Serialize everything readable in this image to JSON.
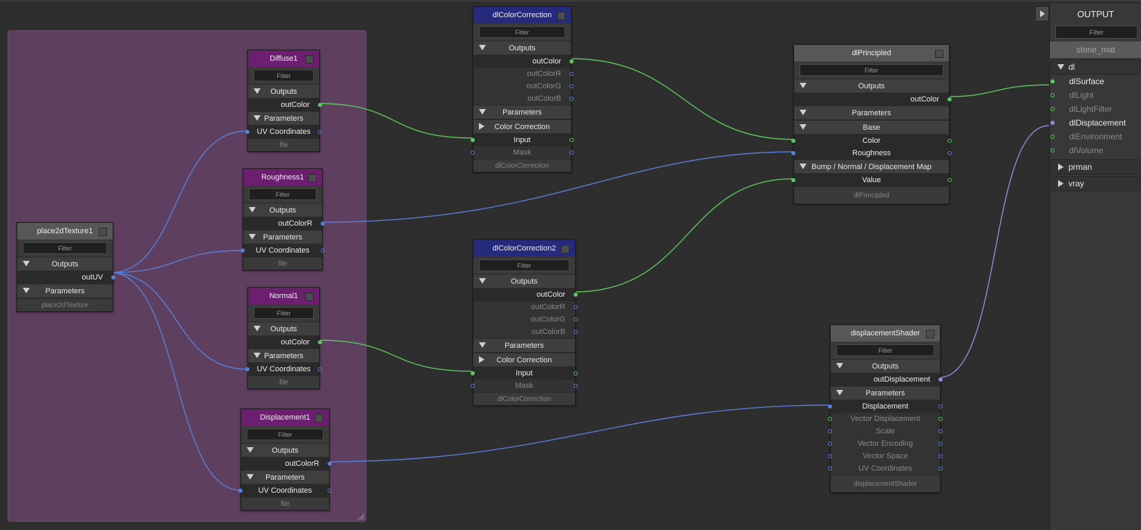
{
  "colors": {
    "canvas_bg": "#2e2e2e",
    "group_bg": "#5e3f5f",
    "file_header": "#6c1f6e",
    "cc_header": "#252a7c",
    "shader_header": "#575757",
    "wire_color": "#5ec65e",
    "wire_float": "#5a7fd8",
    "wire_displacement": "#8d8fd8"
  },
  "filter_placeholder": "Filter",
  "sections": {
    "outputs": "Outputs",
    "parameters": "Parameters",
    "color_correction": "Color Correction",
    "base": "Base",
    "bump": "Bump / Normal / Displacement Map"
  },
  "place2d": {
    "title": "place2dTexture1",
    "out": "outUV",
    "footer": "place2dTexture"
  },
  "diffuse": {
    "title": "Diffuse1",
    "out": "outColor",
    "param": "UV Coordinates",
    "footer": "file"
  },
  "roughness": {
    "title": "Roughness1",
    "out": "outColorR",
    "param": "UV Coordinates",
    "footer": "file"
  },
  "normal": {
    "title": "Normal1",
    "out": "outColor",
    "param": "UV Coordinates",
    "footer": "file"
  },
  "displacement_file": {
    "title": "Displacement1",
    "out": "outColorR",
    "param": "UV Coordinates",
    "footer": "file"
  },
  "cc1": {
    "title": "dlColorCorrection",
    "outs": [
      "outColor",
      "outColorR",
      "outColorG",
      "outColorB"
    ],
    "inputs": [
      "Input",
      "Mask"
    ],
    "footer": "dlColorCorrection"
  },
  "cc2": {
    "title": "dlColorCorrection2",
    "outs": [
      "outColor",
      "outColorR",
      "outColorG",
      "outColorB"
    ],
    "inputs": [
      "Input",
      "Mask"
    ],
    "footer": "dlColorCorrection"
  },
  "principled": {
    "title": "dlPrincipled",
    "out": "outColor",
    "base_params": [
      "Color",
      "Roughness"
    ],
    "bump_params": [
      "Value"
    ],
    "footer": "dlPrincipled"
  },
  "dispshader": {
    "title": "displacementShader",
    "out": "outDisplacement",
    "params": [
      "Displacement",
      "Vector Displacement",
      "Scale",
      "Vector Encoding",
      "Vector Space",
      "UV Coordinates"
    ],
    "footer": "displacementShader"
  },
  "output_panel": {
    "title": "OUTPUT",
    "material": "stone_mat",
    "group_dl": "dl",
    "dl_items": [
      "dlSurface",
      "dlLight",
      "dlLightFilter",
      "dlDisplacement",
      "dlEnvironment",
      "dlVolume"
    ],
    "group_prman": "prman",
    "group_vray": "vray"
  }
}
